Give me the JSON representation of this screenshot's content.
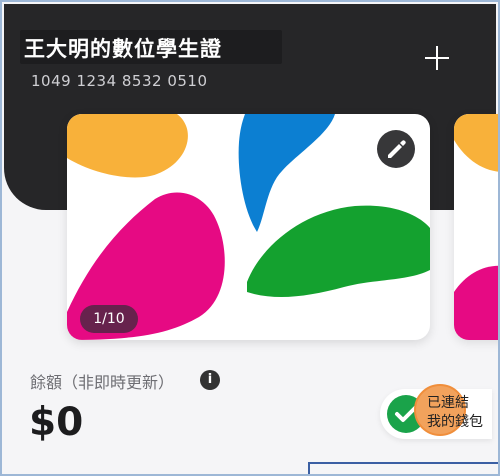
{
  "header": {
    "title": "王大明的數位學生證",
    "card_number": "1049 1234 8532 0510",
    "add_icon": "plus-icon"
  },
  "card": {
    "page_indicator": "1/10",
    "edit_icon": "pencil-icon",
    "colors": {
      "orange": "#f8b13a",
      "blue": "#0c7fd2",
      "pink": "#e60a83",
      "green": "#14a12f"
    }
  },
  "balance": {
    "label": "餘額（非即時更新）",
    "value": "$0",
    "info_icon": "info-icon"
  },
  "wallet": {
    "line1": "已連結",
    "line2": "我的錢包",
    "check_icon": "check-icon",
    "accent": "#1aa34a",
    "highlight": "#f2a25c"
  }
}
